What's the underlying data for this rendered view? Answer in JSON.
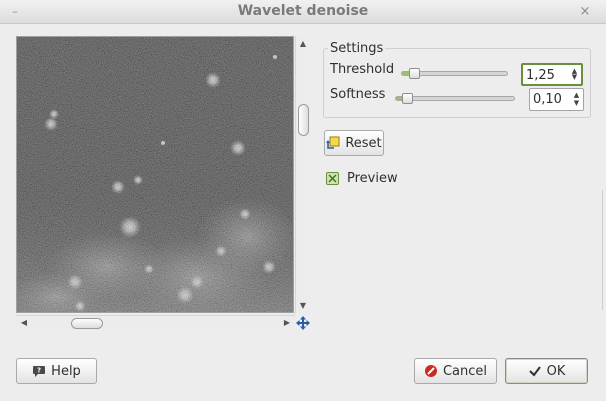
{
  "window": {
    "title": "Wavelet denoise",
    "minimize_glyph": "–",
    "close_glyph": "×"
  },
  "preview_area": {
    "image_description_icon": "preview-image",
    "vscroll": {
      "up_glyph": "▲",
      "down_glyph": "▼"
    },
    "hscroll": {
      "left_glyph": "◀",
      "right_glyph": "▶"
    },
    "navigate_icon": "move-arrows-icon"
  },
  "settings": {
    "title": "Settings",
    "threshold": {
      "label": "Threshold",
      "value": "1,25",
      "slider_fraction": 0.12
    },
    "softness": {
      "label": "Softness",
      "value": "0,10",
      "slider_fraction": 0.1
    },
    "spin_up_glyph": "▲",
    "spin_down_glyph": "▼"
  },
  "actions": {
    "reset_label": "Reset",
    "preview_label": "Preview",
    "preview_checked": true
  },
  "footer": {
    "help_label": "Help",
    "cancel_label": "Cancel",
    "ok_label": "OK"
  },
  "colors": {
    "accent_green": "#9ac26a",
    "focus_green": "#6a8f3d",
    "cancel_red": "#cc2b1e"
  }
}
